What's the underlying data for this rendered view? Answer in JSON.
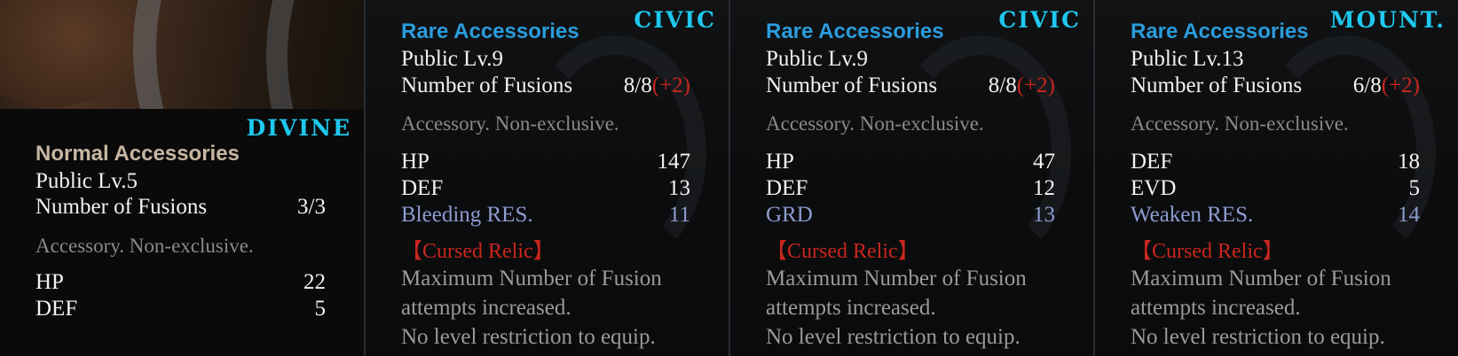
{
  "panels": [
    {
      "category": "DIVINE",
      "rarity": "Normal Accessories",
      "level": "Public Lv.5",
      "fusions_label": "Number of Fusions",
      "fusions_value": "3/3",
      "fusions_bonus": "",
      "description": "Accessory. Non-exclusive.",
      "stats": [
        {
          "name": "HP",
          "value": "22",
          "special": false
        },
        {
          "name": "DEF",
          "value": "5",
          "special": false
        }
      ]
    },
    {
      "category": "CIVIC",
      "rarity": "Rare Accessories",
      "level": "Public Lv.9",
      "fusions_label": "Number of Fusions",
      "fusions_value": "8/8",
      "fusions_bonus": "(+2)",
      "description": "Accessory. Non-exclusive.",
      "stats": [
        {
          "name": "HP",
          "value": "147",
          "special": false
        },
        {
          "name": "DEF",
          "value": "13",
          "special": false
        },
        {
          "name": "Bleeding RES.",
          "value": "11",
          "special": true
        }
      ],
      "relic_title": "【Cursed Relic】",
      "relic_lines": [
        "Maximum Number of Fusion",
        "attempts increased.",
        "No level restriction to equip."
      ]
    },
    {
      "category": "CIVIC",
      "rarity": "Rare Accessories",
      "level": "Public Lv.9",
      "fusions_label": "Number of Fusions",
      "fusions_value": "8/8",
      "fusions_bonus": "(+2)",
      "description": "Accessory. Non-exclusive.",
      "stats": [
        {
          "name": "HP",
          "value": "47",
          "special": false
        },
        {
          "name": "DEF",
          "value": "12",
          "special": false
        },
        {
          "name": "GRD",
          "value": "13",
          "special": true
        }
      ],
      "relic_title": "【Cursed Relic】",
      "relic_lines": [
        "Maximum Number of Fusion",
        "attempts increased.",
        "No level restriction to equip."
      ]
    },
    {
      "category": "MOUNT.",
      "rarity": "Rare Accessories",
      "level": "Public Lv.13",
      "fusions_label": "Number of Fusions",
      "fusions_value": "6/8",
      "fusions_bonus": "(+2)",
      "description": "Accessory. Non-exclusive.",
      "stats": [
        {
          "name": "DEF",
          "value": "18",
          "special": false
        },
        {
          "name": "EVD",
          "value": "5",
          "special": false
        },
        {
          "name": "Weaken RES.",
          "value": "14",
          "special": true
        }
      ],
      "relic_title": "【Cursed Relic】",
      "relic_lines": [
        "Maximum Number of Fusion",
        "attempts increased.",
        "No level restriction to equip."
      ]
    }
  ]
}
